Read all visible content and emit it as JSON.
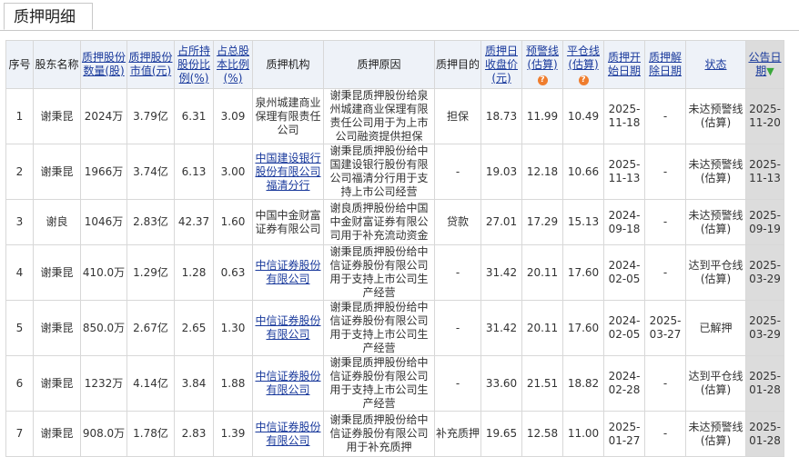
{
  "tab": {
    "title": "质押明细"
  },
  "headers": {
    "seq": "序号",
    "holder": "股东名称",
    "shares": "质押股份数量(股)",
    "market_value": "质押股份市值(元)",
    "pct_holding": "占所持股份比例(%)",
    "pct_total": "占总股本比例(%)",
    "institution": "质押机构",
    "reason": "质押原因",
    "purpose": "质押目的",
    "close_price": "质押日收盘价(元)",
    "warning_line": "预警线(估算)",
    "liquidation_line": "平仓线(估算)",
    "start_date": "质押开始日期",
    "release_date": "质押解除日期",
    "status": "状态",
    "announce_date": "公告日期"
  },
  "rows": [
    {
      "seq": "1",
      "holder": "谢秉昆",
      "shares": "2024万",
      "market_value": "3.79亿",
      "pct_holding": "6.31",
      "pct_total": "3.09",
      "institution": "泉州城建商业保理有限责任公司",
      "institution_link": false,
      "reason": "谢秉昆质押股份给泉州城建商业保理有限责任公司用于为上市公司融资提供担保",
      "purpose": "担保",
      "close_price": "18.73",
      "warning_line": "11.99",
      "liquidation_line": "10.49",
      "start_date": "2025-11-18",
      "release_date": "-",
      "status": "未达预警线(估算)",
      "announce_date": "2025-11-20"
    },
    {
      "seq": "2",
      "holder": "谢秉昆",
      "shares": "1966万",
      "market_value": "3.74亿",
      "pct_holding": "6.13",
      "pct_total": "3.00",
      "institution": "中国建设银行股份有限公司福清分行",
      "institution_link": true,
      "reason": "谢秉昆质押股份给中国建设银行股份有限公司福清分行用于支持上市公司经营",
      "purpose": "-",
      "close_price": "19.03",
      "warning_line": "12.18",
      "liquidation_line": "10.66",
      "start_date": "2025-11-13",
      "release_date": "-",
      "status": "未达预警线(估算)",
      "announce_date": "2025-11-13"
    },
    {
      "seq": "3",
      "holder": "谢良",
      "shares": "1046万",
      "market_value": "2.83亿",
      "pct_holding": "42.37",
      "pct_total": "1.60",
      "institution": "中国中金财富证券有限公司",
      "institution_link": false,
      "reason": "谢良质押股份给中国中金财富证券有限公司用于补充流动资金",
      "purpose": "贷款",
      "close_price": "27.01",
      "warning_line": "17.29",
      "liquidation_line": "15.13",
      "start_date": "2024-09-18",
      "release_date": "-",
      "status": "未达预警线(估算)",
      "announce_date": "2025-09-19"
    },
    {
      "seq": "4",
      "holder": "谢秉昆",
      "shares": "410.0万",
      "market_value": "1.29亿",
      "pct_holding": "1.28",
      "pct_total": "0.63",
      "institution": "中信证券股份有限公司",
      "institution_link": true,
      "reason": "谢秉昆质押股份给中信证券股份有限公司用于支持上市公司生产经营",
      "purpose": "-",
      "close_price": "31.42",
      "warning_line": "20.11",
      "liquidation_line": "17.60",
      "start_date": "2024-02-05",
      "release_date": "-",
      "status": "达到平仓线(估算)",
      "announce_date": "2025-03-29"
    },
    {
      "seq": "5",
      "holder": "谢秉昆",
      "shares": "850.0万",
      "market_value": "2.67亿",
      "pct_holding": "2.65",
      "pct_total": "1.30",
      "institution": "中信证券股份有限公司",
      "institution_link": true,
      "reason": "谢秉昆质押股份给中信证券股份有限公司用于支持上市公司生产经营",
      "purpose": "-",
      "close_price": "31.42",
      "warning_line": "20.11",
      "liquidation_line": "17.60",
      "start_date": "2024-02-05",
      "release_date": "2025-03-27",
      "status": "已解押",
      "announce_date": "2025-03-29"
    },
    {
      "seq": "6",
      "holder": "谢秉昆",
      "shares": "1232万",
      "market_value": "4.14亿",
      "pct_holding": "3.84",
      "pct_total": "1.88",
      "institution": "中信证券股份有限公司",
      "institution_link": true,
      "reason": "谢秉昆质押股份给中信证券股份有限公司用于支持上市公司生产经营",
      "purpose": "-",
      "close_price": "33.60",
      "warning_line": "21.51",
      "liquidation_line": "18.82",
      "start_date": "2024-02-28",
      "release_date": "-",
      "status": "达到平仓线(估算)",
      "announce_date": "2025-01-28"
    },
    {
      "seq": "7",
      "holder": "谢秉昆",
      "shares": "908.0万",
      "market_value": "1.78亿",
      "pct_holding": "2.83",
      "pct_total": "1.39",
      "institution": "中信证券股份有限公司",
      "institution_link": true,
      "reason": "谢秉昆质押股份给中信证券股份有限公司用于补充质押",
      "purpose": "补充质押",
      "close_price": "19.65",
      "warning_line": "12.58",
      "liquidation_line": "11.00",
      "start_date": "2025-01-27",
      "release_date": "-",
      "status": "未达预警线(估算)",
      "announce_date": "2025-01-28"
    }
  ],
  "icons": {
    "help": "question-circle-icon",
    "sort": "sort-down-arrow-icon"
  },
  "colors": {
    "header_bg": "#eef2f8",
    "link": "#1a3a9c",
    "help_icon": "#ef7d2e",
    "sort_arrow": "#3aa83a"
  }
}
